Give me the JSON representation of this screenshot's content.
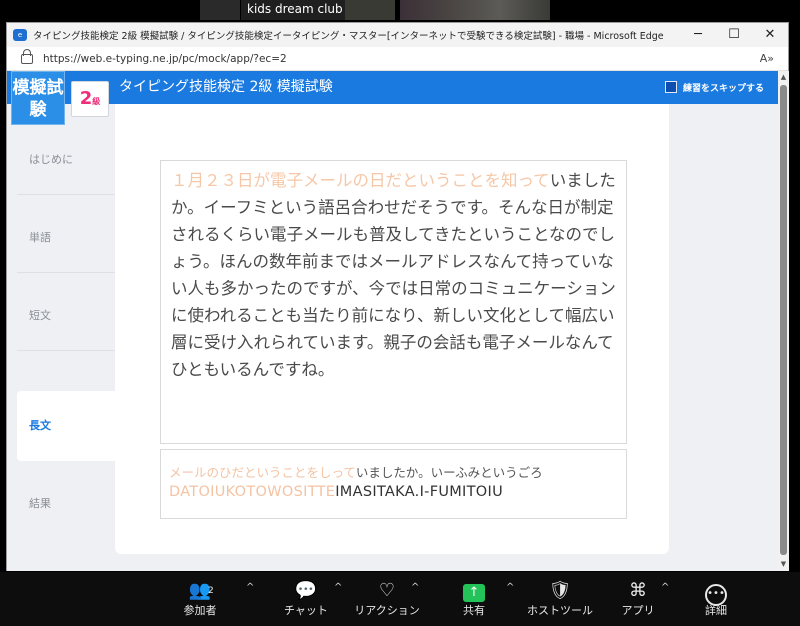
{
  "zoom_top": {
    "participant_name": "kids dream club"
  },
  "window": {
    "title": "タイピング技能検定 2級 模擬試験 / タイピング技能検定イータイピング・マスター[インターネットで受験できる検定試験] - 職場 - Microsoft Edge",
    "minimize": "─",
    "maximize": "☐",
    "close": "✕"
  },
  "address_bar": {
    "url": "https://web.e-typing.ne.jp/pc/mock/app/?ec=2",
    "read_aloud": "A»"
  },
  "header": {
    "mock_badge": "模擬試験",
    "grade_number": "2",
    "grade_suffix": "級",
    "title": "タイピング技能検定 2級 模擬試験",
    "skip_label": "練習をスキップする"
  },
  "sidenav": [
    {
      "label": "はじめに"
    },
    {
      "label": "単語"
    },
    {
      "label": "短文"
    },
    {
      "label": "長文"
    },
    {
      "label": "結果"
    }
  ],
  "passage": {
    "typed": "１月２３日が電子メールの日だということを知って",
    "remaining": "いましたか。イーフミという語呂合わせだそうです。そんな日が制定されるくらい電子メールも普及してきたということなのでしょう。ほんの数年前まではメールアドレスなんて持っていない人も多かったのですが、今では日常のコミュニケーションに使われることも当たり前になり、新しい文化として幅広い層に受け入れられています。親子の会話も電子メールなんてひともいるんですね。"
  },
  "input": {
    "kana_typed": "メールのひだということをしって",
    "kana_remaining": "いましたか。いーふみというごろ",
    "roma_typed": "DATOIUKOTOWOSITTE",
    "roma_remaining": "IMASITAKA.I-FUMITOIU"
  },
  "zoom_toolbar": {
    "participants": {
      "label": "参加者",
      "count": "2"
    },
    "chat": {
      "label": "チャット"
    },
    "reactions": {
      "label": "リアクション"
    },
    "share": {
      "label": "共有"
    },
    "host_tools": {
      "label": "ホストツール"
    },
    "apps": {
      "label": "アプリ"
    },
    "more": {
      "label": "詳細"
    },
    "caret": "^"
  },
  "colors": {
    "accent": "#1a7ae0",
    "grade": "#ef2d7a",
    "typed": "#f6c7a7",
    "share": "#23c35a"
  }
}
